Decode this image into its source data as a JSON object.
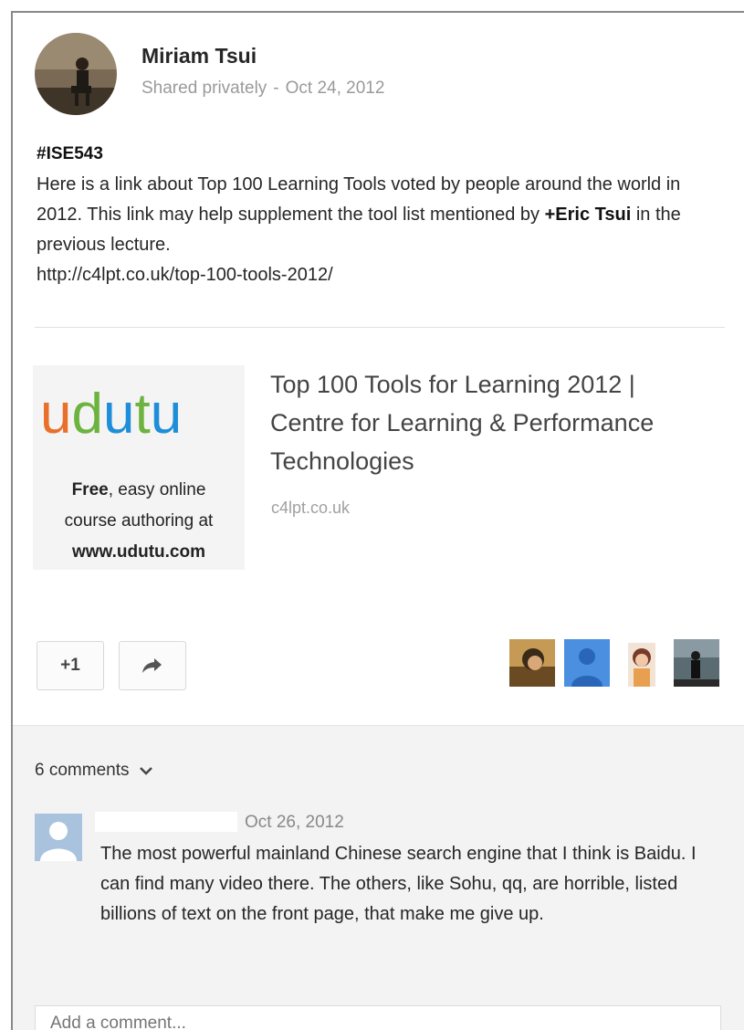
{
  "post": {
    "author": "Miriam Tsui",
    "visibility": "Shared privately",
    "separator": "-",
    "date": "Oct 24, 2012",
    "hashtag": "#ISE543",
    "text_before_mention": "Here is a link about Top 100 Learning Tools voted by people around the world in 2012. This link may help supplement the tool list mentioned by ",
    "mention": "+Eric Tsui",
    "text_after_mention": " in the previous lecture.",
    "url": "http://c4lpt.co.uk/top-100-tools-2012/"
  },
  "link_preview": {
    "ad_logo": "udutu",
    "ad_line1_bold": "Free",
    "ad_line1_rest": ", easy online",
    "ad_line2": "course authoring at",
    "ad_line3": "www.udutu.com",
    "title": "Top 100 Tools for Learning 2012 | Centre for Learning & Performance Technologies",
    "domain": "c4lpt.co.uk"
  },
  "actions": {
    "plus_one_label": "+1",
    "share_icon": "share-arrow-icon"
  },
  "comments": {
    "count_label": "6 comments",
    "toggle_icon": "chevron-down-icon",
    "items": [
      {
        "date": "Oct 26, 2012",
        "text": "The most powerful mainland Chinese search engine that  I think is Baidu. I can find many video there. The others, like Sohu, qq, are horrible, listed billions of text on the front page, that make me give up."
      }
    ],
    "add_placeholder": "Add a comment..."
  },
  "colors": {
    "logo_orange": "#e8702a",
    "logo_green": "#6cb33f",
    "logo_blue": "#1f8ed9",
    "default_avatar": "#4a8fe0"
  }
}
